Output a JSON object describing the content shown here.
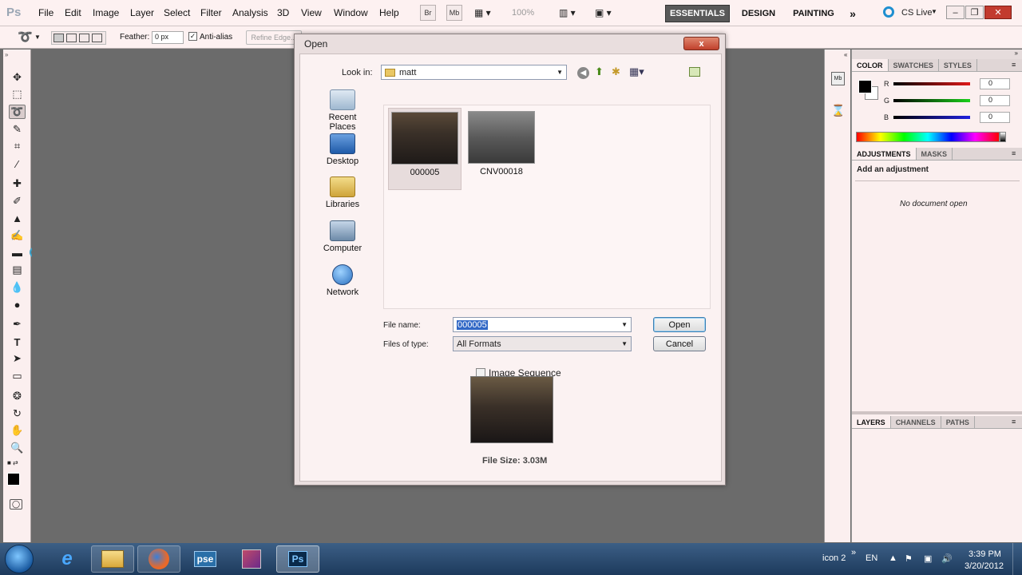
{
  "app": {
    "logo": "Ps",
    "menus": [
      "File",
      "Edit",
      "Image",
      "Layer",
      "Select",
      "Filter",
      "Analysis",
      "3D",
      "View",
      "Window",
      "Help"
    ],
    "bridge": "Br",
    "minibridge": "Mb",
    "zoom": "100%",
    "workspaces": [
      "ESSENTIALS",
      "DESIGN",
      "PAINTING"
    ],
    "more": "»",
    "cslive": "CS Live"
  },
  "options": {
    "feather_label": "Feather:",
    "feather_value": "0 px",
    "antialias_label": "Anti-alias",
    "refine_edge": "Refine Edge..."
  },
  "panels": {
    "color_tabs": [
      "COLOR",
      "SWATCHES",
      "STYLES"
    ],
    "channels": [
      {
        "label": "R",
        "value": "0",
        "color": "#d42020"
      },
      {
        "label": "G",
        "value": "0",
        "color": "#16b816"
      },
      {
        "label": "B",
        "value": "0",
        "color": "#1d1dc8"
      }
    ],
    "adjust_tabs": [
      "ADJUSTMENTS",
      "MASKS"
    ],
    "add_adjustment": "Add an adjustment",
    "no_document": "No document open",
    "layers_tabs": [
      "LAYERS",
      "CHANNELS",
      "PATHS"
    ]
  },
  "dialog": {
    "title": "Open",
    "close": "x",
    "look_in_label": "Look in:",
    "look_in_value": "matt",
    "places": [
      "Recent Places",
      "Desktop",
      "Libraries",
      "Computer",
      "Network"
    ],
    "files": [
      {
        "name": "000005",
        "selected": true
      },
      {
        "name": "CNV00018",
        "selected": false
      }
    ],
    "file_name_label": "File name:",
    "file_name_value": "000005",
    "files_of_type_label": "Files of type:",
    "files_of_type_value": "All Formats",
    "open_button": "Open",
    "cancel_button": "Cancel",
    "image_sequence": "Image Sequence",
    "file_size": "File Size: 3.03M"
  },
  "taskbar": {
    "items": [
      "pse",
      "Ps"
    ],
    "tray_label": "icon 2",
    "tray_more": "»",
    "language": "EN",
    "time": "3:39 PM",
    "date": "3/20/2012"
  }
}
